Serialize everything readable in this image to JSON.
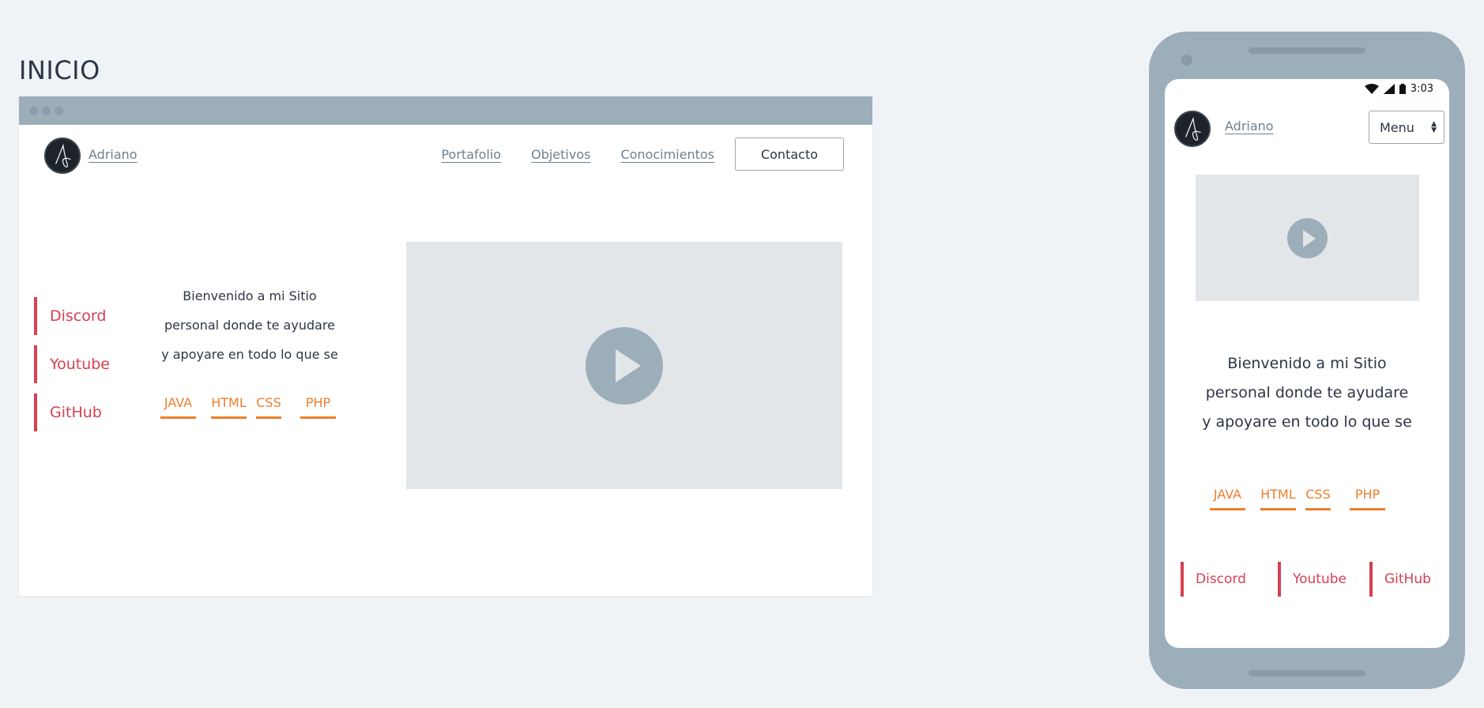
{
  "page": {
    "title": "INICIO"
  },
  "site": {
    "brand": "Adriano",
    "nav": [
      "Portafolio",
      "Objetivos",
      "Conocimientos"
    ],
    "contact_label": "Contacto",
    "intro_lines": [
      "Bienvenido a mi Sitio",
      "personal donde te ayudare",
      "y apoyare en todo lo que se"
    ],
    "skills": [
      "JAVA",
      "HTML",
      "CSS",
      "PHP"
    ],
    "social": [
      "Discord",
      "Youtube",
      "GitHub"
    ]
  },
  "mobile": {
    "time": "3:03",
    "menu_label": "Menu"
  },
  "colors": {
    "accent_social": "#d64051",
    "accent_skill": "#ee7e2c",
    "chrome": "#9daebb",
    "placeholder": "#e3e6e9"
  },
  "icons": [
    "play-icon",
    "wifi-icon",
    "signal-icon",
    "battery-icon",
    "avatar-logo"
  ]
}
